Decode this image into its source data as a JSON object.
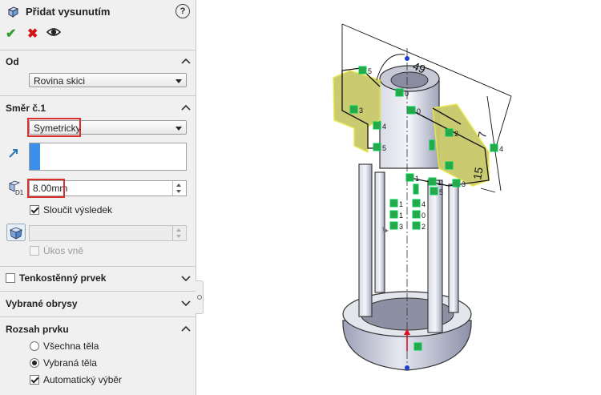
{
  "panel": {
    "title": "Přidat vysunutím",
    "help": "?",
    "ok_icon": "checkmark-icon",
    "cancel_icon": "cross-icon",
    "preview_icon": "eye-icon"
  },
  "from": {
    "title": "Od",
    "value": "Rovina skici"
  },
  "direction1": {
    "title": "Směr č.1",
    "end_condition": "Symetricky",
    "depth": "8.00mm",
    "merge_label": "Sloučit výsledek",
    "merge_checked": true,
    "draft_label": "Úkos vně",
    "draft_checked": false
  },
  "thin_feature": {
    "title": "Tenkostěnný prvek",
    "checked": false
  },
  "selected_contours": {
    "title": "Vybrané obrysy"
  },
  "feature_scope": {
    "title": "Rozsah prvku",
    "all_bodies": "Všechna těla",
    "selected_bodies": "Vybraná těla",
    "auto_select": "Automatický výběr",
    "selected_option": "selected_bodies",
    "auto_select_checked": true
  },
  "dimensions": {
    "width": "49",
    "depth": "15",
    "small": "7"
  },
  "relation_labels": [
    "5",
    "3",
    "4",
    "5",
    "0",
    "0",
    "2",
    "4",
    "1",
    "3",
    "1",
    "5",
    "1",
    "3",
    "4",
    "0",
    "2",
    "1",
    "3",
    "4"
  ],
  "colors": {
    "accent_blue": "#3c8fe8",
    "highlight_red": "#d8302a",
    "ok_green": "#2e9e2e",
    "sketch_yellow": "#e8e84a",
    "relation_green": "#27a84a"
  }
}
